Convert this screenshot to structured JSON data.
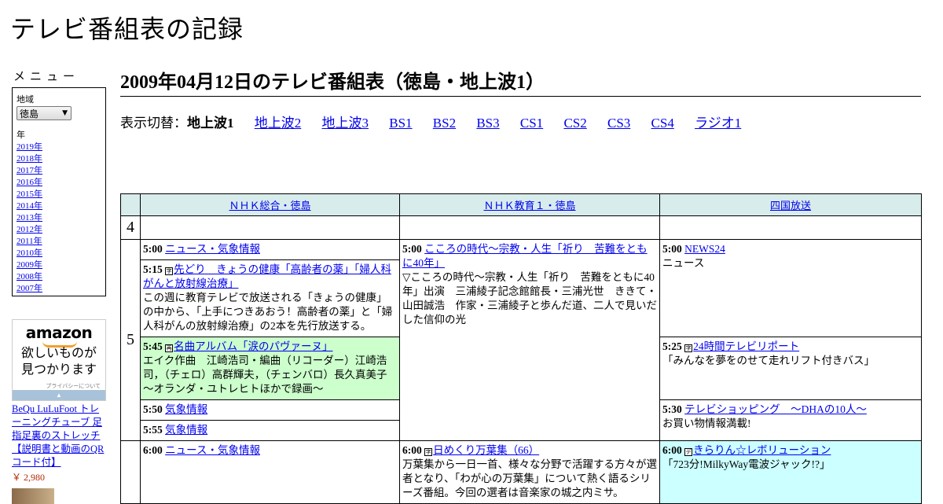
{
  "site_title": "テレビ番組表の記録",
  "sidebar": {
    "menu_title": "メニュー",
    "region_label": "地域",
    "region_value": "徳島",
    "year_label": "年",
    "years": [
      "2019年",
      "2018年",
      "2017年",
      "2016年",
      "2015年",
      "2014年",
      "2013年",
      "2012年",
      "2011年",
      "2010年",
      "2009年",
      "2008年",
      "2007年"
    ]
  },
  "ad": {
    "logo": "amazon",
    "tagline_1": "欲しいものが",
    "tagline_2": "見つかります",
    "privacy": "プライバシーについて",
    "product": "BeQu LuLuFoot トレーニングチューブ 足指足裏のストレッチ【説明書と動画のQRコード付】",
    "price": "￥ 2,980"
  },
  "main": {
    "heading": "2009年04月12日のテレビ番組表（徳島・地上波1）",
    "switch_label": "表示切替：",
    "switch_current": "地上波1",
    "switch_links": [
      "地上波2",
      "地上波3",
      "BS1",
      "BS2",
      "BS3",
      "CS1",
      "CS2",
      "CS3",
      "CS4",
      "ラジオ1"
    ]
  },
  "grid": {
    "channels": [
      "ＮＨＫ総合・徳島",
      "ＮＨＫ教育１・徳島",
      "四国放送"
    ],
    "hours": [
      "4",
      "5"
    ],
    "programs": {
      "c1_0500": {
        "time": "5:00",
        "title": "ニュース・気象情報"
      },
      "c1_0515": {
        "time": "5:15",
        "title": "先どり　きょうの健康「高齢者の薬」「婦人科がんと放射線治療」",
        "desc": "この週に教育テレビで放送される「きょうの健康」の中から、「上手につきあおう！高齢者の薬」と「婦人科がんの放射線治療」の2本を先行放送する。"
      },
      "c1_0545": {
        "time": "5:45",
        "title": "名曲アルバム「涙のパヴァーヌ」",
        "desc": "エイク作曲　江崎浩司・編曲（リコーダー）江崎浩司，（チェロ）高群輝夫，（チェンバロ）長久真美子　～オランダ・ユトレヒトほかで録画～"
      },
      "c1_0550": {
        "time": "5:50",
        "title": "気象情報"
      },
      "c1_0555": {
        "time": "5:55",
        "title": "気象情報"
      },
      "c1_0600": {
        "time": "6:00",
        "title": "ニュース・気象情報"
      },
      "c2_0500": {
        "time": "5:00",
        "title": "こころの時代～宗教・人生「祈り　苦難をともに40年」",
        "desc": "▽こころの時代～宗教・人生「祈り　苦難をともに40年」出演　三浦綾子記念館館長・三浦光世　ききて・山田誠浩　作家・三浦綾子と歩んだ道、二人で見いだした信仰の光"
      },
      "c2_0600": {
        "time": "6:00",
        "title": "日めくり万葉集（66）",
        "desc": "万葉集から一日一首、様々な分野で活躍する方々が選者となり、「わが心の万葉集」について熱く語るシリーズ番組。今回の選者は音楽家の城之内ミサ。"
      },
      "c3_0500": {
        "time": "5:00",
        "title": "NEWS24",
        "desc": "ニュース"
      },
      "c3_0525": {
        "time": "5:25",
        "title": "24時間テレビリポート",
        "desc": "「みんなを夢をのせて走れリフト付きバス」"
      },
      "c3_0530": {
        "time": "5:30",
        "title": "テレビショッピング　～DHAの10人～",
        "desc": "お買い物情報満載!"
      },
      "c3_0600": {
        "time": "6:00",
        "title": "きらりん☆レボリューション",
        "desc": "「723分!MilkyWay電波ジャック!?」"
      }
    }
  }
}
